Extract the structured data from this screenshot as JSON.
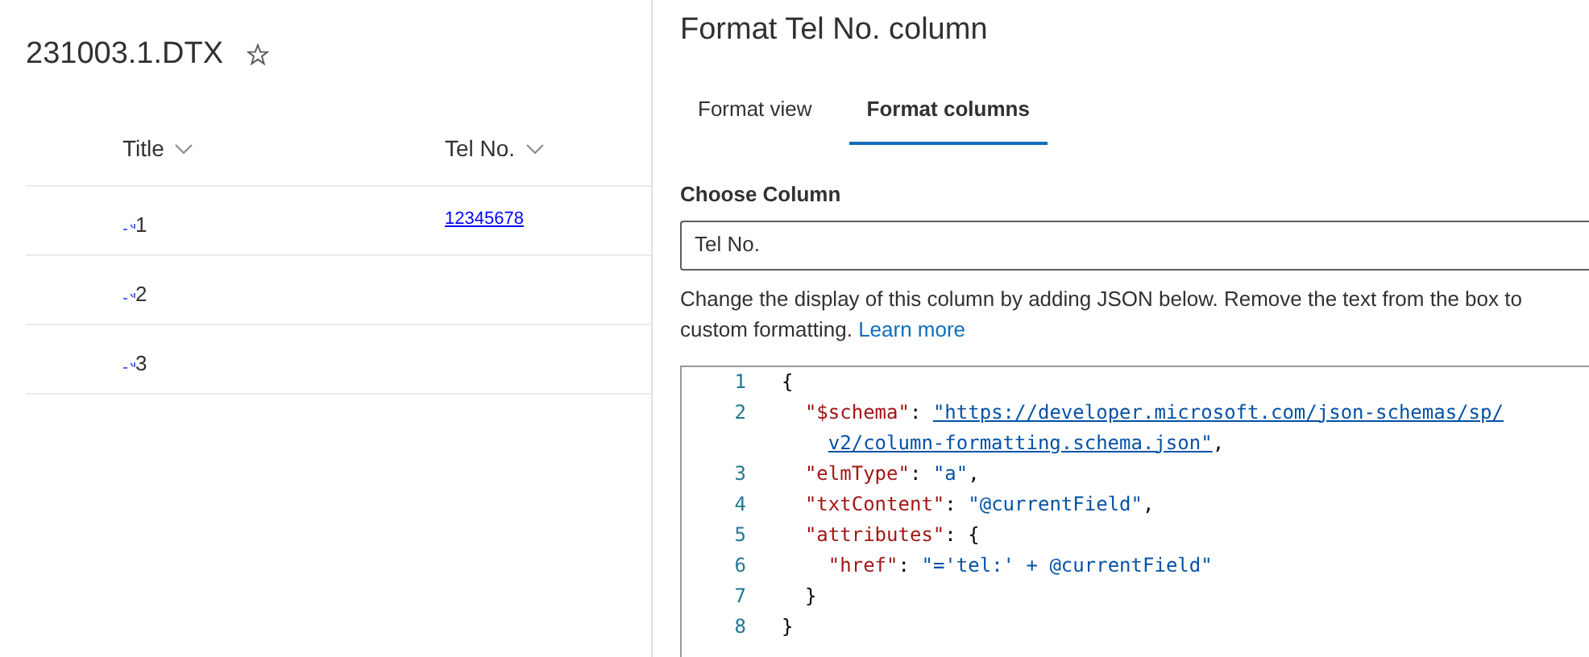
{
  "list": {
    "title": "231003.1.DTX",
    "favorite": false,
    "columns": [
      {
        "label": "Title"
      },
      {
        "label": "Tel No."
      }
    ],
    "rows": [
      {
        "title": "1",
        "new": true,
        "tel": "12345678"
      },
      {
        "title": "2",
        "new": true
      },
      {
        "title": "3",
        "new": true
      }
    ]
  },
  "panel": {
    "title": "Format Tel No. column",
    "tabs": [
      {
        "label": "Format view",
        "selected": false
      },
      {
        "label": "Format columns",
        "selected": true
      }
    ],
    "choose_label": "Choose Column",
    "choose_value": "Tel No.",
    "description": [
      "Change the display of this column by adding JSON below. Remove the text from the box to",
      "custom formatting."
    ],
    "learn_more": "Learn more",
    "code_lines": [
      {
        "number": "1",
        "punct": "{",
        "children": [
          {
            "number": "2",
            "kind": "link",
            "key": "\"$schema\"",
            "punct": ":",
            "value": "\"https://developer.microsoft.com/json-schemas/sp/",
            "wrap": {
              "value": "v2/column-formatting.schema.json\"",
              "end": ","
            }
          },
          {
            "number": "3",
            "kind": "string",
            "key": "\"elmType\"",
            "punct": ":",
            "value": "\"a\"",
            "end": ","
          },
          {
            "number": "4",
            "kind": "string",
            "key": "\"txtContent\"",
            "punct": ":",
            "value": "\"@currentField\"",
            "end": ","
          },
          {
            "number": "5",
            "key": "\"attributes\"",
            "punct": ": {",
            "children": [
              {
                "number": "6",
                "kind": "string",
                "key": "\"href\"",
                "punct": ":",
                "value": "\"='tel:' + @currentField\""
              }
            ]
          },
          {
            "number": "7",
            "punct": "}"
          }
        ]
      },
      {
        "number": "8",
        "punct": "}"
      }
    ]
  }
}
